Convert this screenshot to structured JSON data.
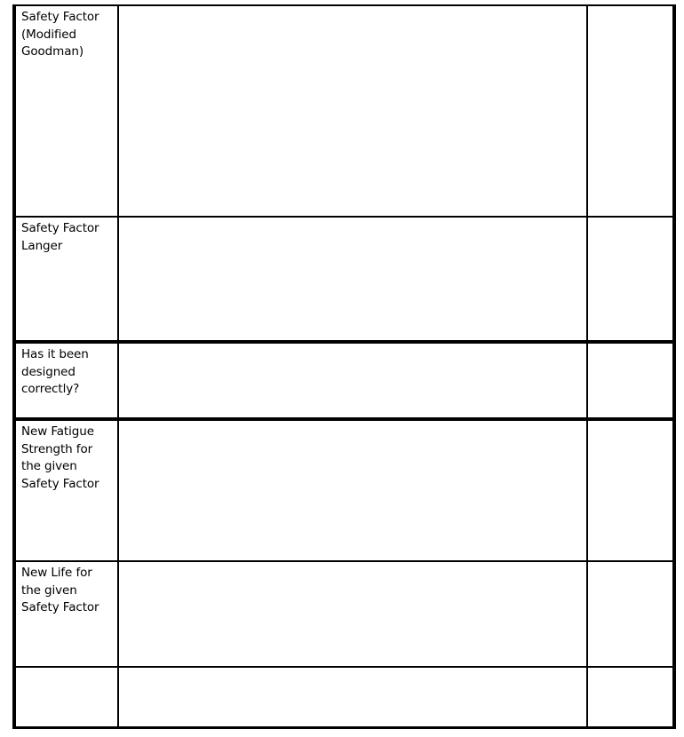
{
  "table": {
    "rows": [
      {
        "label": "Safety Factor (Modified Goodman)",
        "value": "",
        "extra": ""
      },
      {
        "label": "Safety Factor Langer",
        "value": "",
        "extra": ""
      },
      {
        "label": "Has it been designed correctly?",
        "value": "",
        "extra": ""
      },
      {
        "label": "New Fatigue Strength for the given Safety Factor",
        "value": "",
        "extra": ""
      },
      {
        "label": "New Life for the given Safety Factor",
        "value": "",
        "extra": ""
      },
      {
        "label": "",
        "value": "",
        "extra": ""
      }
    ]
  }
}
